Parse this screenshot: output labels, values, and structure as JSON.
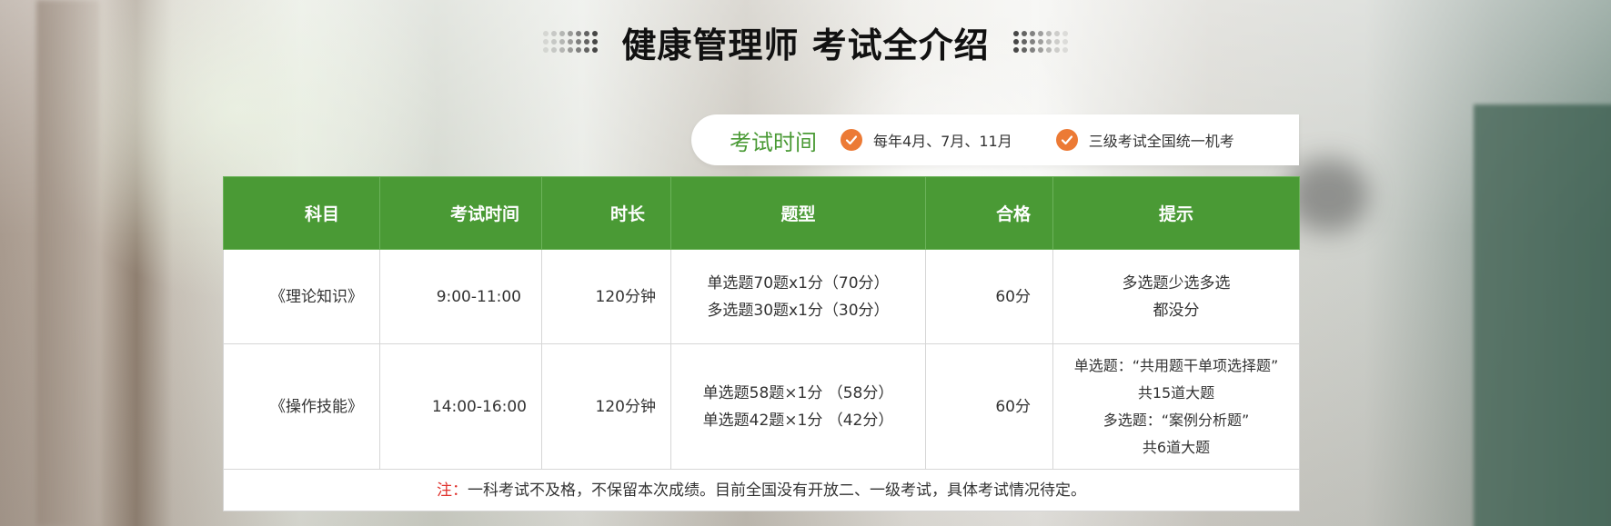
{
  "header": {
    "title": "健康管理师 考试全介绍"
  },
  "info_bar": {
    "label": "考试时间",
    "items": [
      {
        "icon": "check-circle-icon",
        "text": "每年4月、7月、11月"
      },
      {
        "icon": "check-circle-icon",
        "text": "三级考试全国统一机考"
      }
    ]
  },
  "table": {
    "headers": [
      "科目",
      "考试时间",
      "时长",
      "题型",
      "合格",
      "提示"
    ],
    "rows": [
      {
        "subject": "《理论知识》",
        "time": "9:00-11:00",
        "duration": "120分钟",
        "question_types": [
          "单选题70题x1分（70分）",
          "多选题30题x1分（30分）"
        ],
        "pass": "60分",
        "tips": [
          "多选题少选多选",
          "都没分"
        ]
      },
      {
        "subject": "《操作技能》",
        "time": "14:00-16:00",
        "duration": "120分钟",
        "question_types": [
          "单选题58题×1分 （58分）",
          "单选题42题×1分 （42分）"
        ],
        "pass": "60分",
        "tips": [
          "单选题：“共用题干单项选择题”",
          "共15道大题",
          "多选题：“案例分析题”",
          "共6道大题"
        ]
      }
    ],
    "note": {
      "label": "注：",
      "text": "一科考试不及格，不保留本次成绩。目前全国没有开放二、一级考试，具体考试情况待定。"
    }
  },
  "colors": {
    "accent_green": "#4a9a35",
    "check_orange": "#ec7a35",
    "note_red": "#e0322d"
  }
}
